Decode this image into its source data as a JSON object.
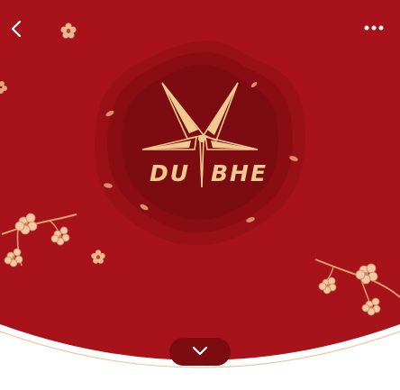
{
  "header": {
    "back_icon": "chevron-left-icon",
    "more_icon": "more-horizontal-icon"
  },
  "logo": {
    "text_left": "DU",
    "text_right": "BHE",
    "emblem_icon": "compass-star-icon"
  },
  "footer": {
    "expand_icon": "chevron-down-icon"
  },
  "colors": {
    "background_red": "#a8121a",
    "dark_red": "#8b0d14",
    "gold": "#f2c98f",
    "white": "#ffffff"
  }
}
